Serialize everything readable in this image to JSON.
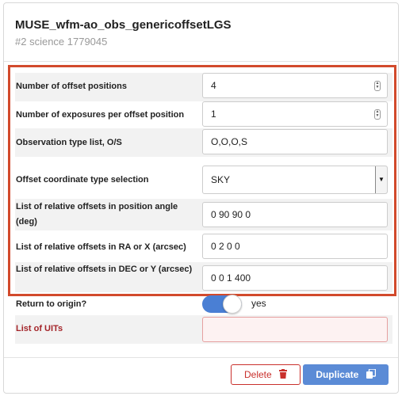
{
  "header": {
    "title": "MUSE_wfm-ao_obs_genericoffsetLGS",
    "subtitle": "#2 science 1779045"
  },
  "params": {
    "offset_positions": {
      "label": "Number of offset positions",
      "value": "4"
    },
    "exposures_per_offset": {
      "label": "Number of exposures per offset position",
      "value": "1"
    },
    "obs_type_list": {
      "label": "Observation type list, O/S",
      "value": "O,O,O,S"
    },
    "offset_coord_type": {
      "label": "Offset coordinate type selection",
      "value": "SKY"
    },
    "rel_offsets_pa": {
      "label": "List of relative offsets in position angle (deg)",
      "value": "0 90 90 0"
    },
    "rel_offsets_ra": {
      "label": "List of relative offsets in RA or X (arcsec)",
      "value": "0 2 0 0"
    },
    "rel_offsets_dec": {
      "label": "List of relative offsets in DEC or Y (arcsec)",
      "value": "0 0 1 400"
    },
    "return_to_origin": {
      "label": "Return to origin?",
      "value": "yes",
      "enabled": true
    },
    "list_of_uits": {
      "label": "List of UITs",
      "value": ""
    }
  },
  "footer": {
    "delete_label": "Delete",
    "duplicate_label": "Duplicate"
  },
  "icons": {
    "spinner": "up-down-spinner-icon",
    "select": "dropdown-arrow-icon",
    "delete": "trash-icon",
    "duplicate": "copy-icon"
  },
  "colors": {
    "highlight_border": "#d24a2c",
    "accent_blue": "#5b8bd6",
    "toggle_blue": "#4a7fd4",
    "danger_red": "#c9302c",
    "invalid_label": "#a4252a"
  }
}
